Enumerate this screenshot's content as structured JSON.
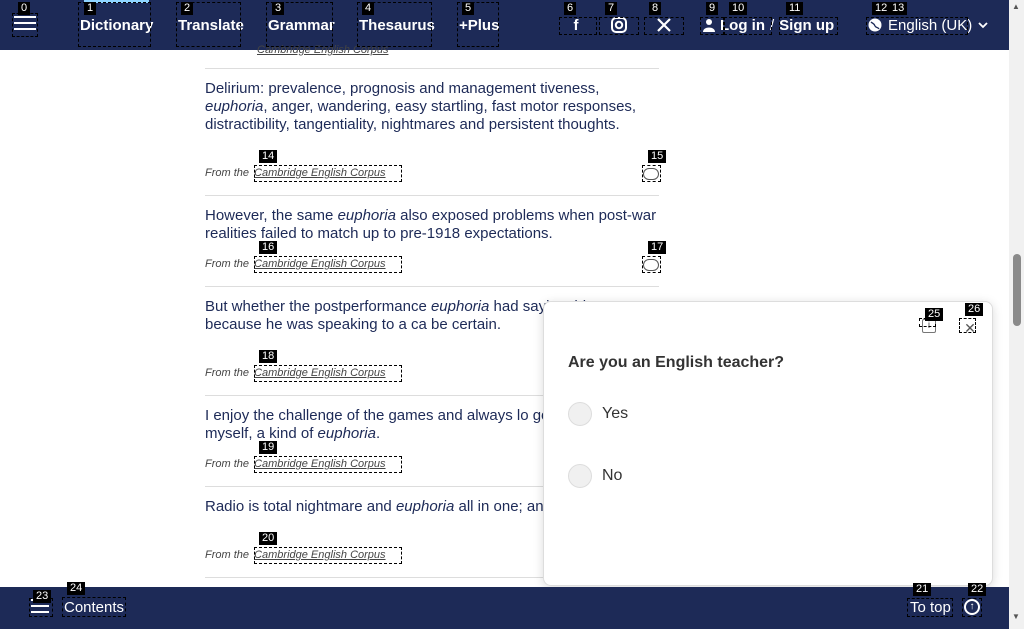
{
  "topbar": {
    "nav": [
      "Dictionary",
      "Translate",
      "Grammar",
      "Thesaurus",
      "+Plus"
    ],
    "social": [
      "facebook-icon",
      "instagram-icon",
      "x-icon"
    ],
    "login": "Log in",
    "slash": "/",
    "signup": "Sign up",
    "language": "English (UK)"
  },
  "prev_source": "Cambridge English Corpus",
  "examples": [
    {
      "before": "Delirium: prevalence, prognosis and management tiveness, ",
      "keyword": "euphoria",
      "after": ", anger, wandering, easy startling, fast motor responses, distractibility, tangentiality, nightmares and persistent thoughts.",
      "from": "From the",
      "source": "Cambridge English Corpus"
    },
    {
      "before": "However, the same ",
      "keyword": "euphoria",
      "after": " also exposed problems when post-war realities failed to match up to pre-1918 expectations.",
      "from": "From the",
      "source": "Cambridge English Corpus"
    },
    {
      "before": "But whether the postperformance ",
      "keyword": "euphoria",
      "after": " had saying this, or because he was speaking to a ca be certain.",
      "from": "From the",
      "source": "Cambridge English Corpus"
    },
    {
      "before": "I enjoy the challenge of the games and always lo good about myself, a kind of ",
      "keyword": "euphoria",
      "after": ".",
      "from": "From the",
      "source": "Cambridge English Corpus"
    },
    {
      "before": "Radio is total nightmare and ",
      "keyword": "euphoria",
      "after": " all in one; and fantastic.",
      "from": "From the",
      "source": "Cambridge English Corpus"
    }
  ],
  "popup": {
    "question": "Are you an English teacher?",
    "options": [
      "Yes",
      "No"
    ]
  },
  "bottombar": {
    "contents": "Contents",
    "to_top": "To top"
  },
  "badges": [
    "0",
    "1",
    "2",
    "3",
    "4",
    "5",
    "6",
    "7",
    "8",
    "9",
    "10",
    "11",
    "12",
    "13",
    "14",
    "15",
    "16",
    "17",
    "18",
    "19",
    "20",
    "21",
    "22",
    "23",
    "24",
    "25",
    "26"
  ]
}
